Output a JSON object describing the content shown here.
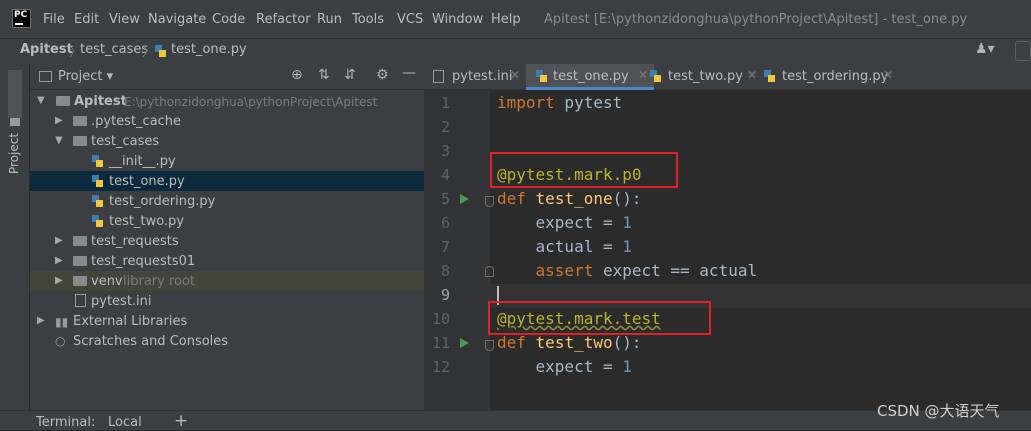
{
  "app": {
    "logo_text": "PC"
  },
  "menu": [
    "File",
    "Edit",
    "View",
    "Navigate",
    "Code",
    "Refactor",
    "Run",
    "Tools",
    "VCS",
    "Window",
    "Help"
  ],
  "window_title": "Apitest [E:\\pythonzidonghua\\pythonProject\\Apitest] - test_one.py",
  "breadcrumb": {
    "root": "Apitest",
    "folder": "test_cases",
    "file": "test_one.py"
  },
  "left_strip": {
    "project_tab": "Project"
  },
  "project_panel": {
    "title": "Project",
    "tree": [
      {
        "label": "Apitest",
        "extra": "E:\\pythonzidonghua\\pythonProject\\Apitest"
      },
      {
        "label": ".pytest_cache"
      },
      {
        "label": "test_cases"
      },
      {
        "label": "__init__.py"
      },
      {
        "label": "test_one.py"
      },
      {
        "label": "test_ordering.py"
      },
      {
        "label": "test_two.py"
      },
      {
        "label": "test_requests"
      },
      {
        "label": "test_requests01"
      },
      {
        "label": "venv",
        "extra": "library root"
      },
      {
        "label": "pytest.ini"
      },
      {
        "label": "External Libraries"
      },
      {
        "label": "Scratches and Consoles"
      }
    ]
  },
  "tabs": [
    {
      "label": "pytest.ini"
    },
    {
      "label": "test_one.py"
    },
    {
      "label": "test_two.py"
    },
    {
      "label": "test_ordering.py"
    }
  ],
  "line_numbers": [
    "1",
    "2",
    "3",
    "4",
    "5",
    "6",
    "7",
    "8",
    "9",
    "10",
    "11",
    "12"
  ],
  "code": {
    "l1_kw": "import",
    "l1_rest": " pytest",
    "l4": "@pytest.mark.p0",
    "l5_kw": "def",
    "l5_fn": "test_one",
    "l5_rest": "():",
    "l6_a": "    expect = ",
    "l6_n": "1",
    "l7_a": "    actual = ",
    "l7_n": "1",
    "l8_kw": "    assert",
    "l8_rest": " expect == actual",
    "l10": "@pytest.mark.test",
    "l11_kw": "def",
    "l11_fn": "test_two",
    "l11_rest": "():",
    "l12_a": "    expect = ",
    "l12_n": "1"
  },
  "bottom": {
    "terminal_label": "Terminal:",
    "local_tab": "Local",
    "add_symbol": "+"
  },
  "watermark": "CSDN @大语天气",
  "colors": {
    "accent": "#4a88c7",
    "highlight_box": "#e0202a",
    "selection": "#0d293e"
  }
}
